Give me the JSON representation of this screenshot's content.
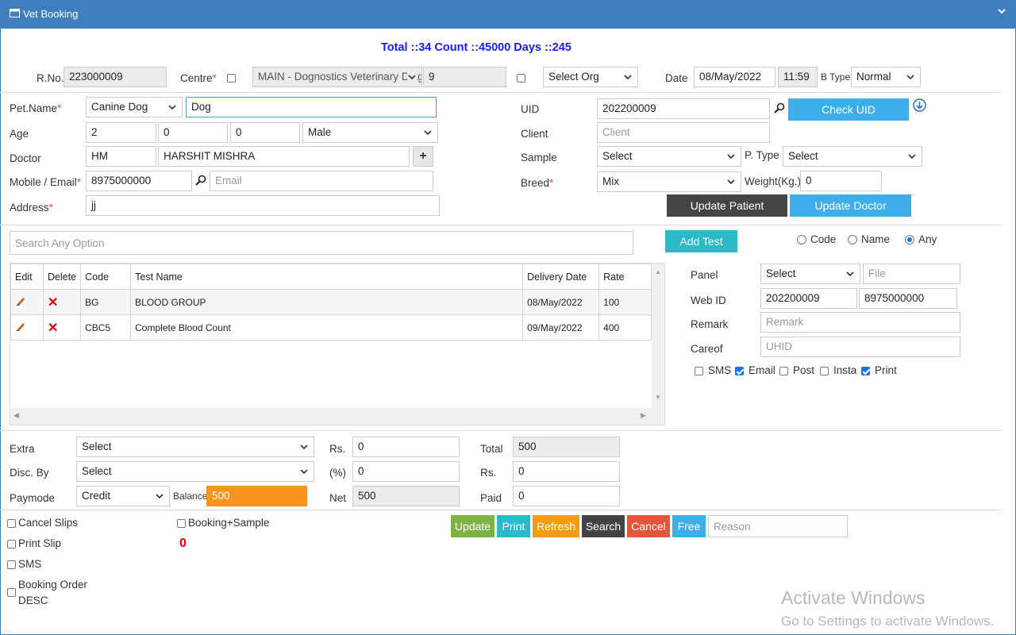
{
  "window": {
    "title": "Vet Booking"
  },
  "summary": "Total ::34 Count ::45000 Days ::245",
  "top": {
    "rno_label": "R.No.",
    "rno": "223000009",
    "centre_label": "Centre",
    "centre_value": "MAIN - Dognostics Veterinary Diag",
    "centre_code": "9",
    "org_value": "Select Org",
    "date_label": "Date",
    "date": "08/May/2022",
    "time": "11:59",
    "btype_label": "B Type",
    "btype": "Normal"
  },
  "patient": {
    "petname_label": "Pet.Name",
    "species": "Canine  Dog",
    "petname": "Dog",
    "age_label": "Age",
    "age_y": "2",
    "age_m": "0",
    "age_d": "0",
    "gender": "Male",
    "doctor_label": "Doctor",
    "doctor_code": "HM",
    "doctor_name": "HARSHIT MISHRA",
    "mobile_label": "Mobile / Email",
    "mobile": "8975000000",
    "email_placeholder": "Email",
    "address_label": "Address",
    "address": "jj",
    "uid_label": "UID",
    "uid": "202200009",
    "check_uid": "Check UID",
    "client_label": "Client",
    "client_placeholder": "Client",
    "sample_label": "Sample",
    "sample": "Select",
    "ptype_label": "P. Type",
    "ptype": "Select",
    "breed_label": "Breed",
    "breed": "Mix",
    "weight_label": "Weight(Kg.)",
    "weight": "0",
    "update_patient": "Update Patient",
    "update_doctor": "Update Doctor"
  },
  "search": {
    "placeholder": "Search Any Option",
    "add_test": "Add Test",
    "opt_code": "Code",
    "opt_name": "Name",
    "opt_any": "Any"
  },
  "tests": {
    "headers": [
      "Edit",
      "Delete",
      "Code",
      "Test Name",
      "Delivery Date",
      "Rate"
    ],
    "rows": [
      {
        "code": "BG",
        "name": "BLOOD GROUP",
        "date": "08/May/2022",
        "rate": "100"
      },
      {
        "code": "CBC5",
        "name": "Complete Blood Count",
        "date": "09/May/2022",
        "rate": "400"
      }
    ]
  },
  "side": {
    "panel_label": "Panel",
    "panel": "Select",
    "file_placeholder": "File",
    "webid_label": "Web ID",
    "webid": "202200009",
    "webid_mobile": "8975000000",
    "remark_label": "Remark",
    "remark_placeholder": "Remark",
    "careof_label": "Careof",
    "careof_placeholder": "UHID",
    "sms": "SMS",
    "email": "Email",
    "post": "Post",
    "insta": "Insta",
    "print": "Print"
  },
  "billing": {
    "extra_label": "Extra",
    "extra": "Select",
    "discby_label": "Disc. By",
    "discby": "Select",
    "paymode_label": "Paymode",
    "paymode": "Credit",
    "balance_label": "Balance",
    "balance": "500",
    "rs_label": "Rs.",
    "rs": "0",
    "pct_label": "(%)",
    "pct": "0",
    "net_label": "Net",
    "net": "500",
    "total_label": "Total",
    "total": "500",
    "rs2_label": "Rs.",
    "rs2": "0",
    "paid_label": "Paid",
    "paid": "0"
  },
  "footer": {
    "cancel_slips": "Cancel Slips",
    "booking_sample": "Booking+Sample",
    "print_slip": "Print Slip",
    "count": "0",
    "sms": "SMS",
    "booking_order": "Booking Order",
    "desc": "DESC",
    "update": "Update",
    "print": "Print",
    "refresh": "Refresh",
    "search": "Search",
    "cancel": "Cancel",
    "free": "Free",
    "reason_placeholder": "Reason"
  },
  "watermark": {
    "line1": "Activate Windows",
    "line2": "Go to Settings to activate Windows."
  },
  "colors": {
    "header_blue": "#3f7fbf",
    "btn_blue": "#3daee9",
    "btn_dark": "#444444",
    "btn_teal": "#2bbbc8",
    "btn_green": "#7cb342",
    "btn_orange": "#f39c12",
    "btn_red": "#e0573c",
    "balance_orange": "#f7941d",
    "summary_blue": "#1a1aff"
  }
}
